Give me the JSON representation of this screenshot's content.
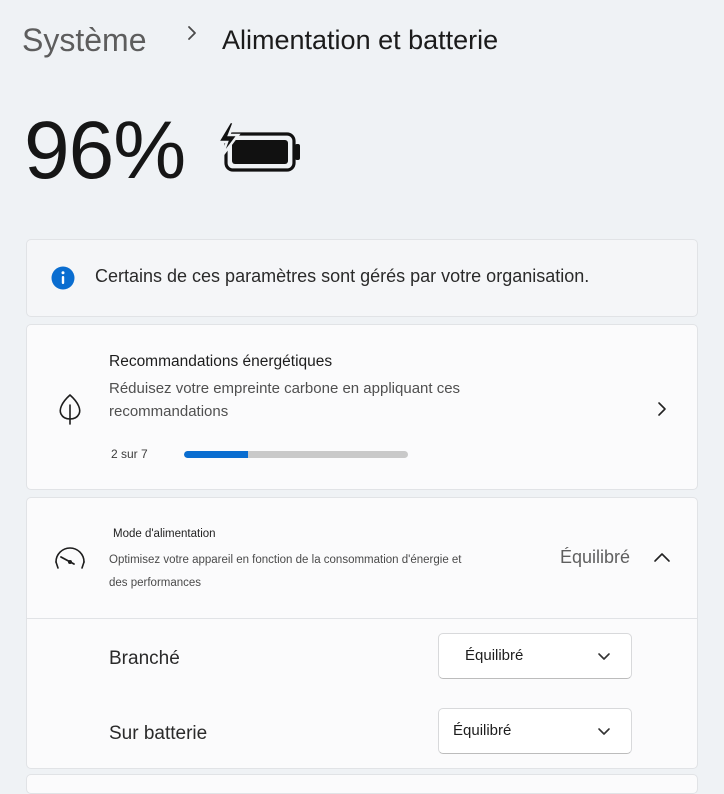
{
  "header": {
    "breadcrumb_parent": "Système",
    "breadcrumb_current": "Alimentation et batterie"
  },
  "battery": {
    "percent_text": "96%",
    "charging": true,
    "icon": "battery-charging-icon"
  },
  "notice": {
    "icon": "info-icon",
    "text": "Certains de ces paramètres sont gérés par votre organisation."
  },
  "recommendations": {
    "icon": "leaf-icon",
    "title": "Recommandations énergétiques",
    "description": "Réduisez votre empreinte carbone en appliquant ces recommandations",
    "progress_text": "2 sur 7",
    "progress_fraction": 0.2857
  },
  "power_mode": {
    "icon": "gauge-icon",
    "title": "Mode d'alimentation",
    "description": "Optimisez votre appareil en fonction de la consommation d'énergie et des performances",
    "current_value": "Équilibré",
    "expanded": true,
    "rows": [
      {
        "label": "Branché",
        "selected": "Équilibré"
      },
      {
        "label": "Sur batterie",
        "selected": "Équilibré"
      }
    ]
  },
  "colors": {
    "accent": "#0a6dd0",
    "background": "#eff2f5",
    "card": "#fbfbfc"
  }
}
